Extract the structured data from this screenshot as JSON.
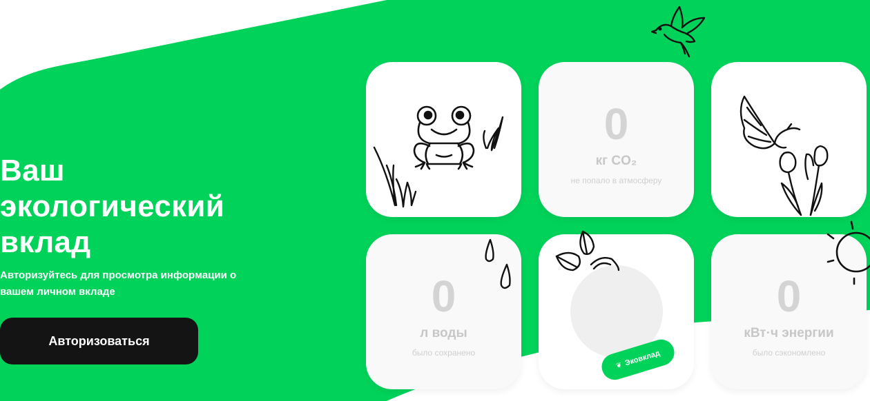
{
  "hero": {
    "title_line1": "Ваш",
    "title_line2": "экологический",
    "title_line3": "вклад",
    "subtitle": "Авторизуйтесь для просмотра информации о вашем личном вкладе",
    "login_button": "Авторизоваться"
  },
  "stats": {
    "co2": {
      "value": "0",
      "unit": "кг CO₂",
      "caption": "не попало в атмосферу"
    },
    "water": {
      "value": "0",
      "unit": "л воды",
      "caption": "было сохранено"
    },
    "energy": {
      "value": "0",
      "unit": "кВт·ч энергии",
      "caption": "было сэкономлено"
    }
  },
  "badge": {
    "label": "Эковклад",
    "icon": "sprout-icon"
  },
  "illustrations": [
    "frog-icon",
    "grass-icon",
    "bird-icon",
    "butterfly-icon",
    "flowers-icon",
    "water-drops-icon",
    "leaves-icon",
    "sun-icon"
  ],
  "colors": {
    "brand_green": "#00d25a",
    "button_dark": "#141414",
    "card_bg": "#f9f9f9",
    "stat_gray": "#d4d4d4"
  }
}
